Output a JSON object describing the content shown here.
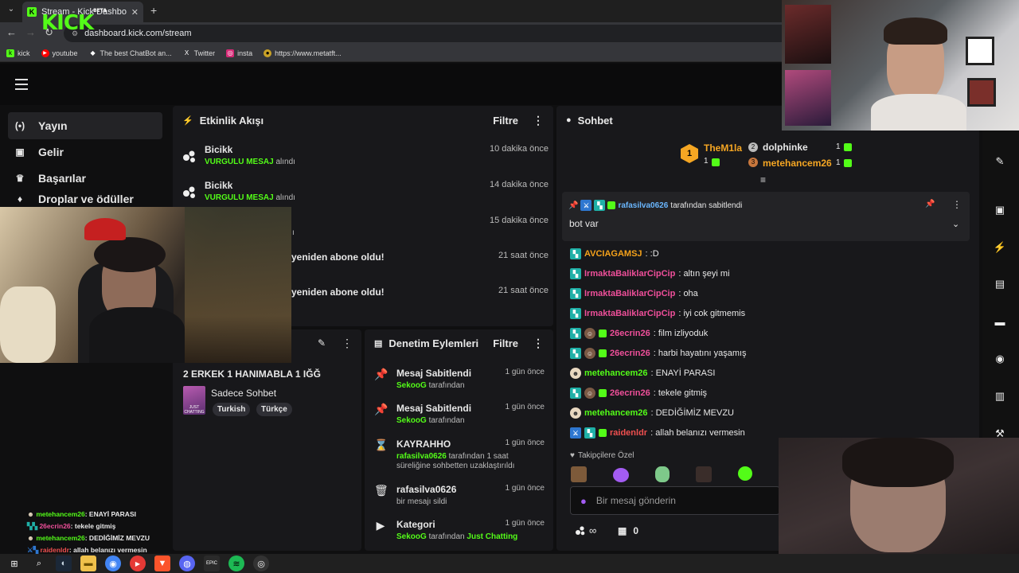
{
  "browser": {
    "tab_title": "Stream - Kick Dashboard",
    "url": "dashboard.kick.com/stream",
    "bookmarks": [
      {
        "label": "kick",
        "icon": "kick-icon"
      },
      {
        "label": "youtube",
        "icon": "youtube-icon"
      },
      {
        "label": "The best ChatBot an...",
        "icon": "chatbot-icon"
      },
      {
        "label": "Twitter",
        "icon": "x-icon"
      },
      {
        "label": "insta",
        "icon": "instagram-icon"
      },
      {
        "label": "https://www.metatft...",
        "icon": "metatft-icon"
      }
    ]
  },
  "app": {
    "logo": "KICK",
    "logo_badge": "BETA"
  },
  "sidebar": {
    "items": [
      {
        "label": "Yayın",
        "icon": "broadcast-icon"
      },
      {
        "label": "Gelir",
        "icon": "revenue-icon"
      },
      {
        "label": "Başarılar",
        "icon": "trophy-icon"
      },
      {
        "label": "Droplar ve ödüller",
        "icon": "drops-icon"
      }
    ]
  },
  "activity": {
    "title": "Etkinlik Akışı",
    "filter": "Filtre",
    "events": [
      {
        "name": "Bicikk",
        "highlight": "VURGULU MESAJ",
        "suffix": "alındı",
        "time": "10 dakika önce"
      },
      {
        "name": "Bicikk",
        "highlight": "VURGULU MESAJ",
        "suffix": "alındı",
        "time": "14 dakika önce"
      },
      {
        "name": "",
        "highlight": "",
        "suffix": "ı",
        "time": "15 dakika önce"
      },
      {
        "name": "yeniden abone oldu!",
        "highlight": "",
        "suffix": "",
        "time": "21 saat önce"
      },
      {
        "name": "yeniden abone oldu!",
        "highlight": "",
        "suffix": "",
        "time": "21 saat önce"
      }
    ]
  },
  "stream_info": {
    "title": "2 ERKEK 1 HANIMABLA 1 IĞĞ",
    "category": "Sadece Sohbet",
    "category_thumb": "JUST CHATTING",
    "tags": [
      "Turkish",
      "Türkçe"
    ]
  },
  "moderation": {
    "title": "Denetim Eylemleri",
    "filter": "Filtre",
    "actions": [
      {
        "icon": "pin-icon",
        "title": "Mesaj Sabitlendi",
        "actor": "SekooG",
        "text": "tarafından",
        "time": "1 gün önce"
      },
      {
        "icon": "pin-icon",
        "title": "Mesaj Sabitlendi",
        "actor": "SekooG",
        "text": "tarafından",
        "time": "1 gün önce"
      },
      {
        "icon": "hourglass-icon",
        "title": "KAYRAHHO",
        "actor": "rafasilva0626",
        "text": "tarafından 1 saat süreliğine sohbetten uzaklaştırıldı",
        "time": "1 gün önce"
      },
      {
        "icon": "trash-icon",
        "title": "rafasilva0626",
        "actor": "",
        "text": "bir mesajı sildi",
        "time": "1 gün önce"
      },
      {
        "icon": "category-icon",
        "title": "Kategori",
        "actor": "SekooG",
        "text": "tarafından",
        "extra": "Just Chatting",
        "time": "1 gün önce"
      }
    ]
  },
  "chat": {
    "title": "Sohbet",
    "leaderboard": {
      "first": {
        "rank": "1",
        "name": "TheM1la",
        "count": "1"
      },
      "second": {
        "name": "dolphinke",
        "count": "1"
      },
      "third": {
        "name": "metehancem26",
        "count": "1"
      }
    },
    "pinned": {
      "by": "rafasilva0626",
      "by_suffix": "tarafından sabitlendi",
      "text": "bot var"
    },
    "messages": [
      {
        "user": "AVCIAGAMSJ",
        "color": "#f6a21a",
        "text": ": :D"
      },
      {
        "user": "IrmaktaBaliklarCipCip",
        "color": "#ef4f9a",
        "text": ": altın şeyi mi"
      },
      {
        "user": "IrmaktaBaliklarCipCip",
        "color": "#ef4f9a",
        "text": ": oha"
      },
      {
        "user": "IrmaktaBaliklarCipCip",
        "color": "#ef4f9a",
        "text": ": iyi cok gitmemis"
      },
      {
        "user": "26ecrin26",
        "color": "#ef4f9a",
        "text": ": film izliyoduk"
      },
      {
        "user": "26ecrin26",
        "color": "#ef4f9a",
        "text": ": harbi hayatını yaşamış"
      },
      {
        "user": "metehancem26",
        "color": "#53fc18",
        "text": ": ENAYİ PARASI"
      },
      {
        "user": "26ecrin26",
        "color": "#ef4f9a",
        "text": ": tekele gitmiş"
      },
      {
        "user": "metehancem26",
        "color": "#53fc18",
        "text": ": DEDİĞİMİZ MEVZU"
      },
      {
        "user": "raidenldr",
        "color": "#ef4f4f",
        "text": ": allah belanızı vermesin"
      }
    ],
    "followers_only": "Takipçilere Özel",
    "input_placeholder": "Bir mesaj gönderin",
    "points": "∞",
    "gift_count": "0"
  },
  "overlay_chat": [
    {
      "user": "metehancem26",
      "color": "#53fc18",
      "text": ": ENAYİ PARASI"
    },
    {
      "user": "26ecrin26",
      "color": "#ef4f9a",
      "text": ": tekele gitmiş"
    },
    {
      "user": "metehancem26",
      "color": "#53fc18",
      "text": ": DEDİĞİMİZ MEVZU"
    },
    {
      "user": "raidenldr",
      "color": "#ef4f4f",
      "text": ": allah belanızı vermesin"
    }
  ],
  "colors": {
    "accent": "#53fc18",
    "panel": "#18181b",
    "background": "#0f0f10"
  }
}
